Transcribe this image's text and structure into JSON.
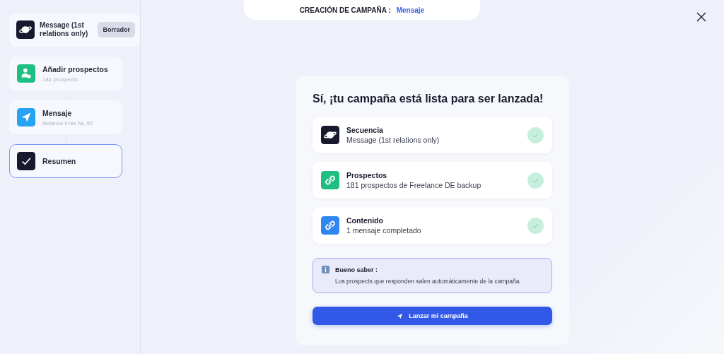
{
  "header": {
    "label": "CREACIÓN DE CAMPAÑA :",
    "value": "Mensaje"
  },
  "sequence": {
    "title": "Message (1st relations only)",
    "badge": "Borrador",
    "kind": "planet"
  },
  "steps": [
    {
      "title": "Añadir prospectos",
      "subtitle": "181 prospects",
      "kind": "person",
      "selected": false
    },
    {
      "title": "Mensaje",
      "subtitle": "Relance Free NL #2",
      "kind": "send",
      "selected": false
    },
    {
      "title": "Resumen",
      "kind": "check",
      "selected": true
    }
  ],
  "summary": {
    "title": "Sí, ¡tu campaña está lista para ser lanzada!",
    "items": [
      {
        "title": "Secuencia",
        "detail": "Message (1st relations only)",
        "kind": "planet",
        "done": true
      },
      {
        "title": "Prospectos",
        "detail": "181 prospectos de Freelance DE backup",
        "kind": "link-green",
        "done": true
      },
      {
        "title": "Contenido",
        "detail": "1 mensaje completado",
        "kind": "link-blue",
        "done": true
      }
    ],
    "info": {
      "title": "Bueno saber :",
      "text": "Los prospects que responden salen automáticamente de la campaña."
    },
    "button": "Lanzar mi campaña"
  }
}
